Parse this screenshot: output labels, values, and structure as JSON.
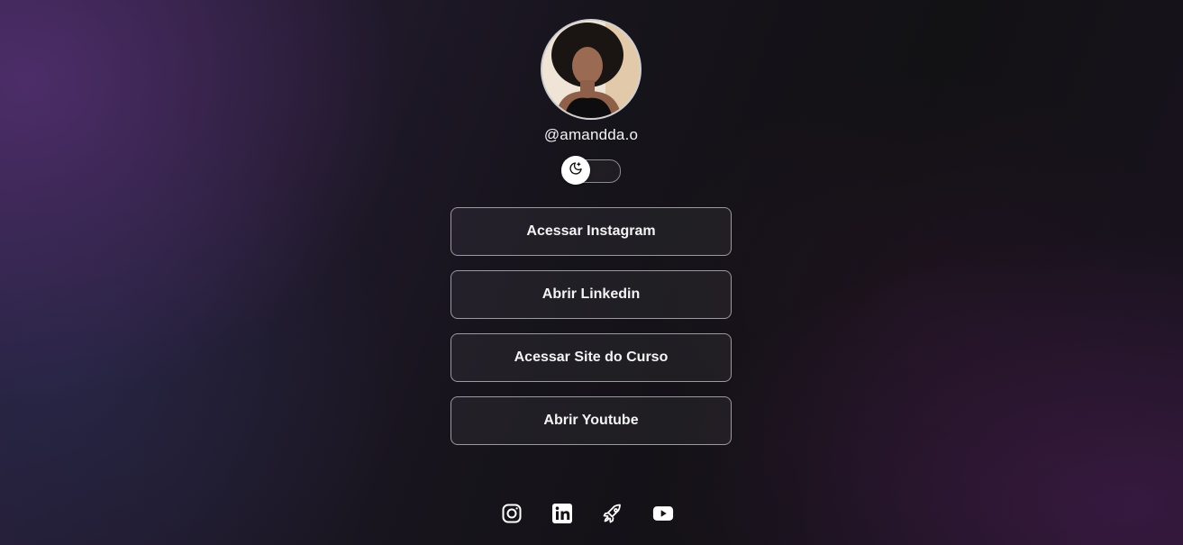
{
  "profile": {
    "handle": "@amandda.o",
    "avatar": "profile-photo"
  },
  "theme_switch": {
    "icon": "moon-icon",
    "state": "dark"
  },
  "links": [
    {
      "label": "Acessar Instagram"
    },
    {
      "label": "Abrir Linkedin"
    },
    {
      "label": "Acessar Site do Curso"
    },
    {
      "label": "Abrir Youtube"
    }
  ],
  "socials": [
    {
      "icon": "instagram-icon"
    },
    {
      "icon": "linkedin-icon"
    },
    {
      "icon": "rocket-icon"
    },
    {
      "icon": "youtube-icon"
    }
  ],
  "colors": {
    "text": "#f4f4f5",
    "border": "#9a9aa0",
    "background_dark": "#101012",
    "accent_purple": "#583278"
  }
}
